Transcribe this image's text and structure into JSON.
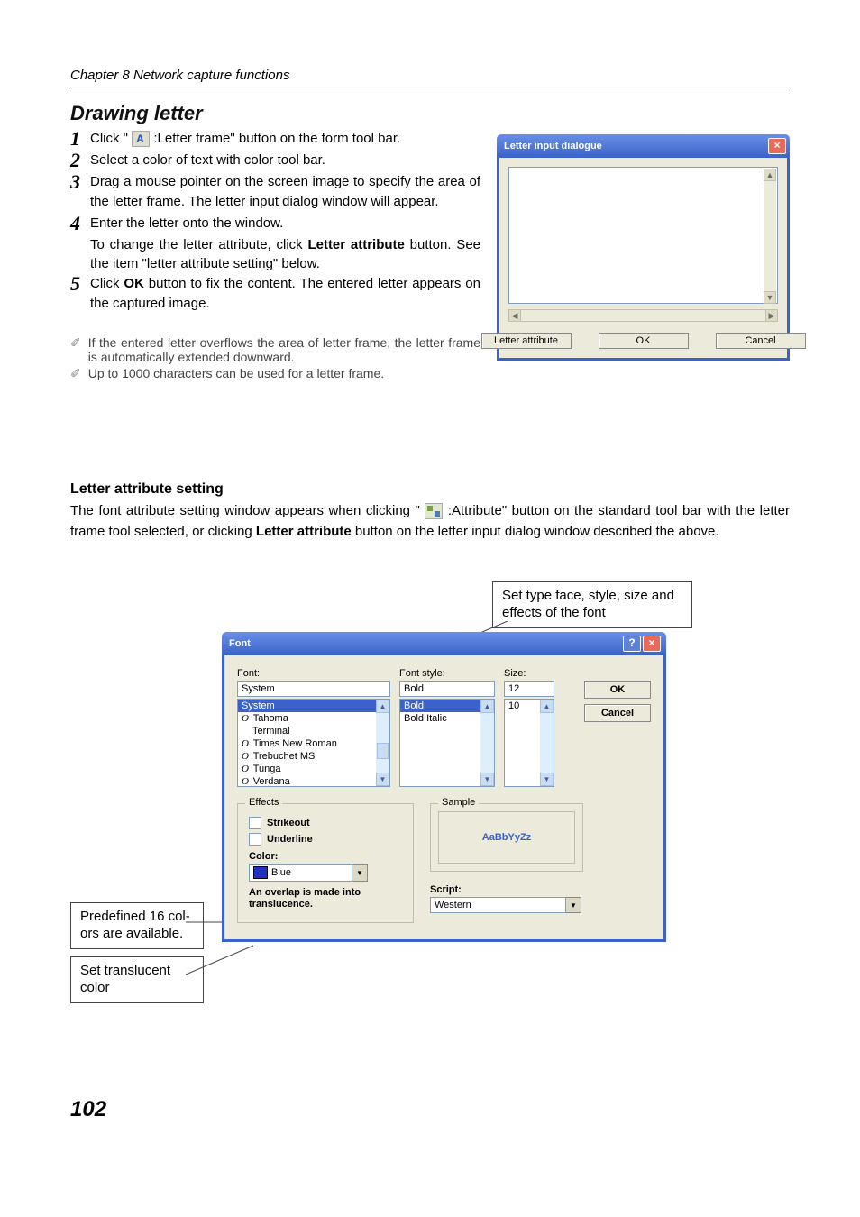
{
  "header": {
    "chapter": "Chapter 8 Network capture functions"
  },
  "section": {
    "title": "Drawing letter"
  },
  "steps": {
    "s1a": "Click \"",
    "s1b": ":Letter frame\" button on the form tool bar.",
    "s2": "Select a color of text with color tool bar.",
    "s3": "Drag a mouse pointer on the screen image to specify the area of the letter frame. The letter input dialog window will appear.",
    "s4": "Enter the letter onto the window.",
    "s4sub_a": "To change the letter attribute, click ",
    "s4sub_bold": "Letter attribute",
    "s4sub_b": " button. See the item \"letter attribute setting\" below.",
    "s5a": "Click ",
    "s5bold": "OK",
    "s5b": " button to fix the content. The entered letter appears on the captured image."
  },
  "notes": {
    "n1": "If the entered letter overflows the area of letter frame, the letter frame is automatically extended downward.",
    "n2": "Up to 1000 characters can be used for a letter frame."
  },
  "letter_dialog": {
    "title": "Letter  input  dialogue",
    "btn_attr": "Letter attribute",
    "btn_ok": "OK",
    "btn_cancel": "Cancel"
  },
  "subsection": {
    "title": "Letter attribute setting",
    "p1a": "The font attribute setting window appears when clicking \"",
    "p1b": " :Attribute\" button on the standard tool bar with the letter frame tool selected, or clicking ",
    "p1bold": "Letter attribute",
    "p1c": " button on the letter input dialog window described the above."
  },
  "callouts": {
    "typeface": "Set type face, style, size and effects of the font",
    "colors": "Predefined 16 col-\nors are available.",
    "translucent": "Set translucent color"
  },
  "font_dialog": {
    "title": "Font",
    "font_label": "Font:",
    "font_value": "System",
    "font_list": [
      "System",
      "Tahoma",
      "Terminal",
      "Times New Roman",
      "Trebuchet MS",
      "Tunga",
      "Verdana"
    ],
    "style_label": "Font style:",
    "style_value": "Bold",
    "style_list": [
      "Bold",
      "Bold Italic"
    ],
    "size_label": "Size:",
    "size_value": "12",
    "size_list": [
      "10"
    ],
    "ok": "OK",
    "cancel": "Cancel",
    "effects_label": "Effects",
    "strikeout": "Strikeout",
    "underline": "Underline",
    "color_label": "Color:",
    "color_value": "Blue",
    "overlap_note": "An overlap is made into translucence.",
    "sample_label": "Sample",
    "sample_text": "AaBbYyZz",
    "script_label": "Script:",
    "script_value": "Western"
  },
  "page_number": "102"
}
